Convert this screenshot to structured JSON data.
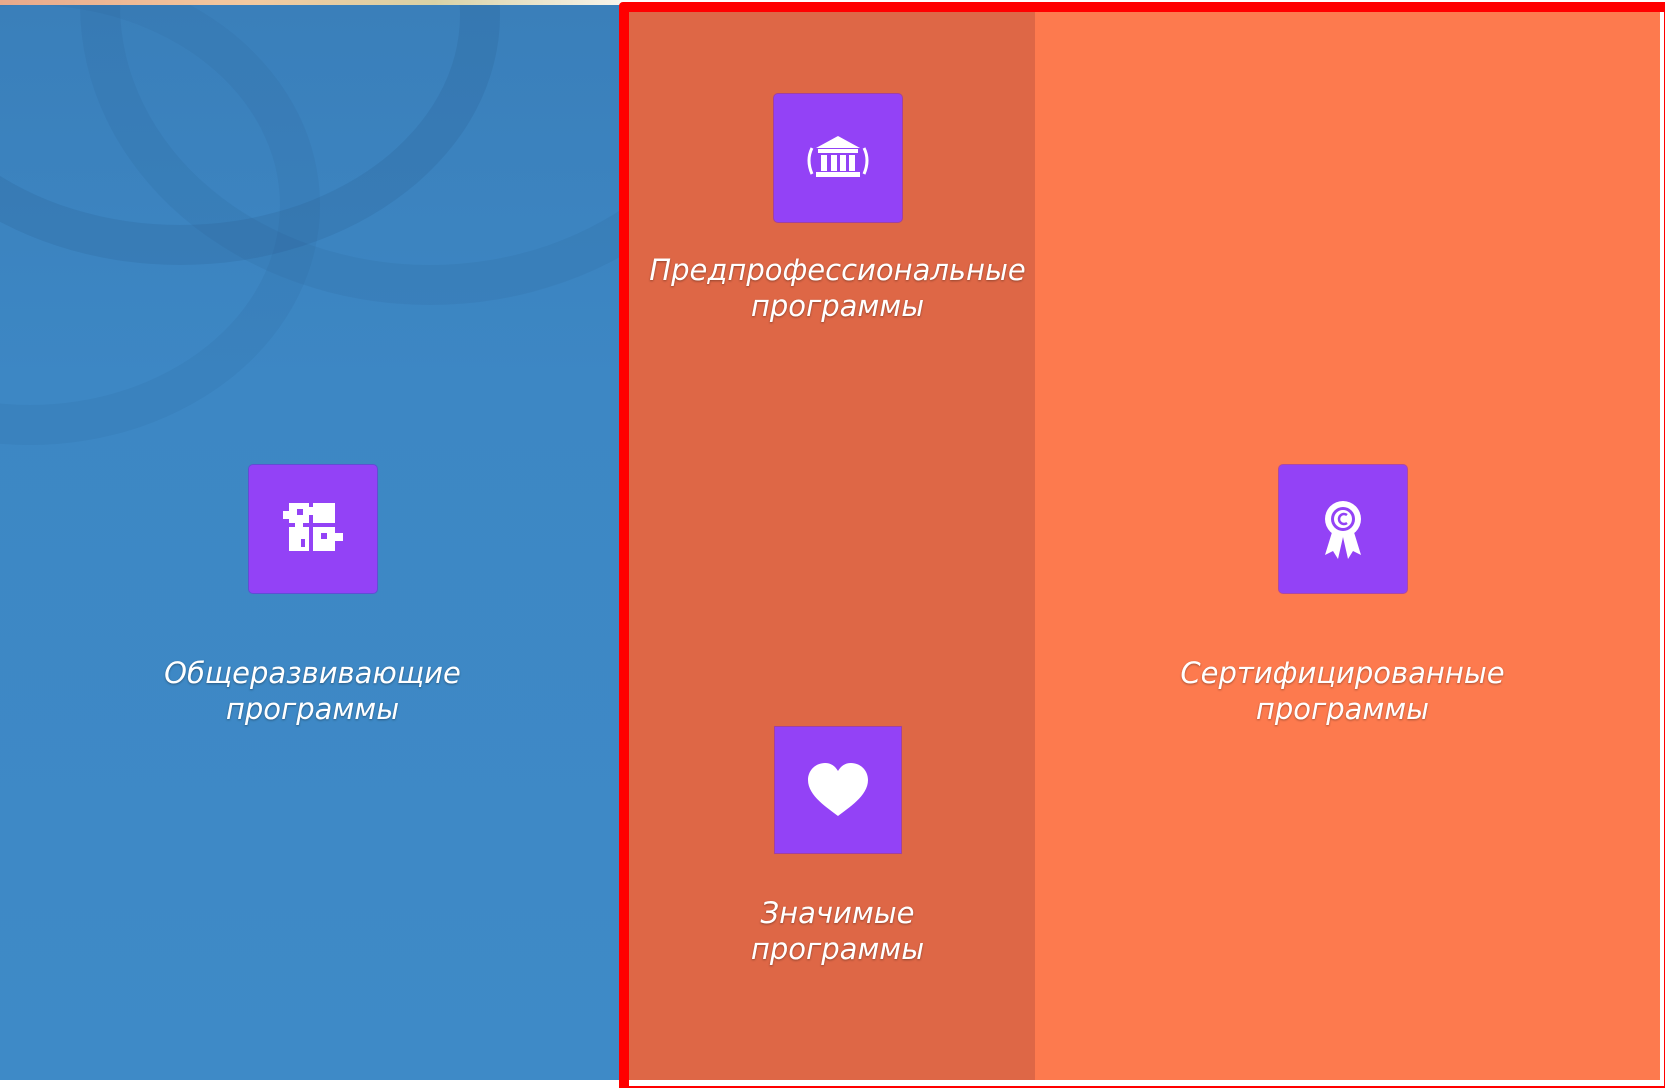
{
  "cards": {
    "general": {
      "icon": "puzzle-icon",
      "line1": "Общеразвивающие",
      "line2": "программы"
    },
    "preprofessional": {
      "icon": "institution-icon",
      "line1": "Предпрофессиональные",
      "line2": "программы"
    },
    "significant": {
      "icon": "heart-icon",
      "line1": "Значимые",
      "line2": "программы"
    },
    "certified": {
      "icon": "certificate-ribbon-icon",
      "line1": "Сертифицированные",
      "line2": "программы"
    }
  },
  "colors": {
    "left_panel": "#3e8ac7",
    "middle_panel": "#de6746",
    "right_panel": "#fd7a4e",
    "icon_tile": "#9342f6",
    "highlight_frame": "#ff0000"
  }
}
